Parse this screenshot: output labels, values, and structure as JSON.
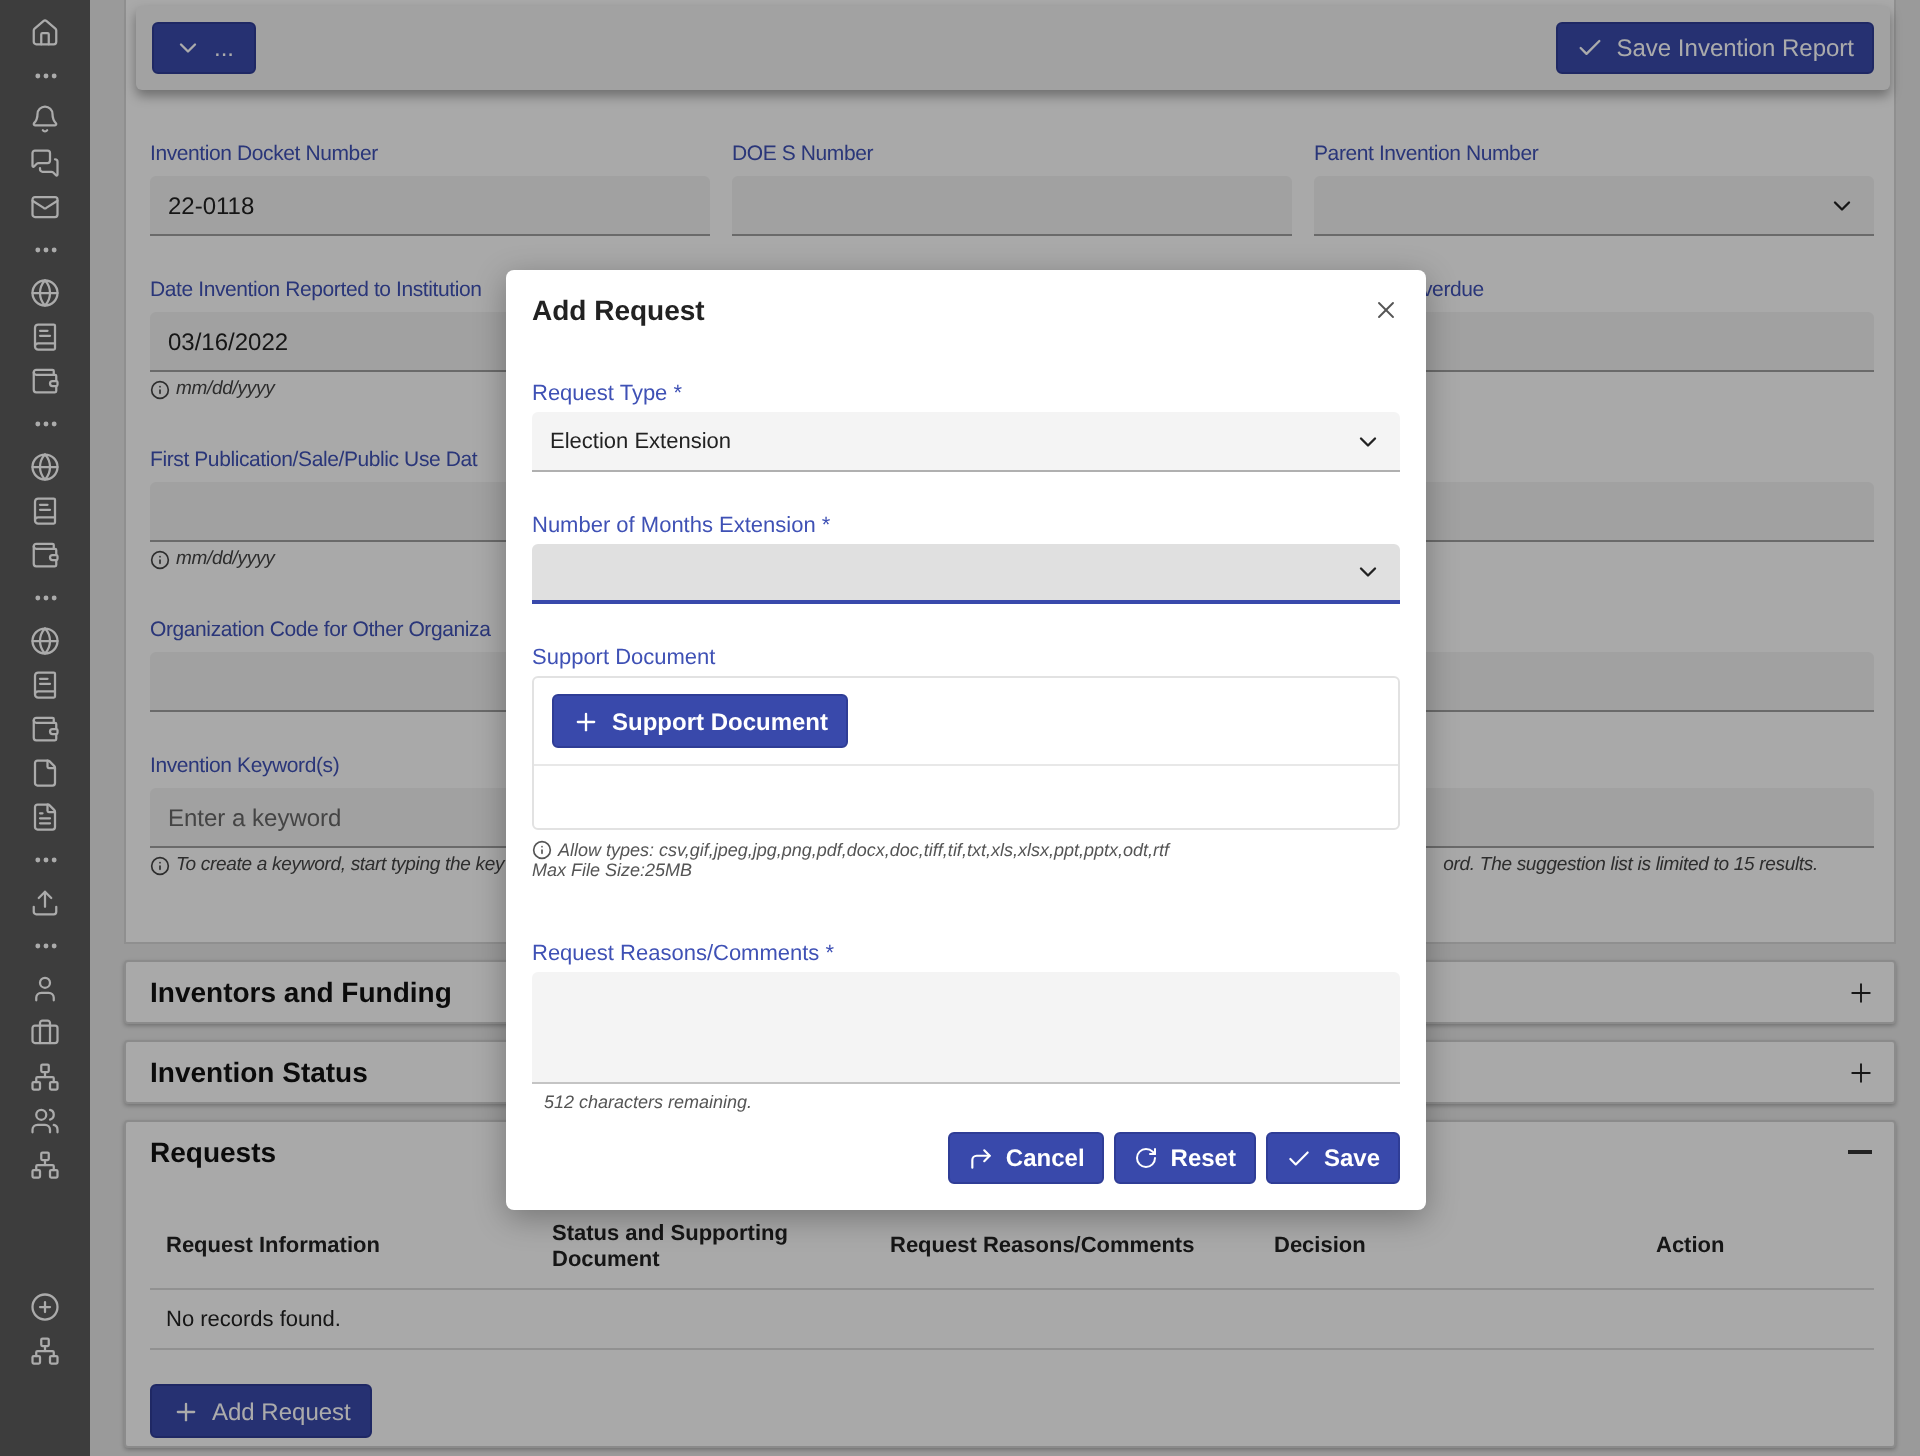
{
  "toolbar": {
    "menu_button": "...",
    "save_button": "Save Invention Report"
  },
  "form": {
    "rows": [
      {
        "fields": [
          {
            "kind": "text",
            "label": "Invention Docket Number",
            "value": "22-0118"
          },
          {
            "kind": "text",
            "label": "DOE S Number"
          },
          {
            "kind": "select",
            "label": "Parent Invention Number"
          }
        ]
      },
      {
        "fields": [
          {
            "kind": "text",
            "label": "Date Invention Reported to Institution",
            "value": "03/16/2022",
            "hint": "mm/dd/yyyy"
          },
          {
            "kind": "text",
            "label": "verdue"
          }
        ]
      },
      {
        "fields": [
          {
            "kind": "text",
            "label": "First Publication/Sale/Public Use Dat",
            "hint": "mm/dd/yyyy"
          },
          {
            "kind": "text"
          }
        ]
      },
      {
        "fields": [
          {
            "kind": "text",
            "label": "Organization Code for Other Organiza"
          },
          {
            "kind": "text"
          }
        ]
      },
      {
        "fields": [
          {
            "kind": "keyword",
            "label": "Invention Keyword(s)",
            "placeholder": "Enter a keyword",
            "hint_parts": [
              "To create a keyword, start typing the key",
              "ord. The suggestion list is limited to 15 results."
            ]
          }
        ]
      }
    ]
  },
  "sections": [
    {
      "title": "Inventors and Funding",
      "expanded": false
    },
    {
      "title": "Invention Status",
      "expanded": false
    },
    {
      "title": "Requests",
      "expanded": true,
      "table": {
        "columns": [
          "Request Information",
          "Status and Supporting Document",
          "Request Reasons/Comments",
          "Decision",
          "Action"
        ],
        "empty_message": "No records found."
      },
      "add_button": "Add Request"
    }
  ],
  "dialog": {
    "title": "Add Request",
    "fields": [
      {
        "kind": "select",
        "label": "Request Type *",
        "value": "Election Extension",
        "focused": false
      },
      {
        "kind": "select",
        "label": "Number of Months Extension *",
        "focused": true
      },
      {
        "kind": "upload",
        "label": "Support Document",
        "button": "Support Document",
        "hint": "Allow types: csv,gif,jpeg,jpg,png,pdf,docx,doc,tiff,tif,txt,xls,xlsx,ppt,pptx,odt,rtf",
        "note": "Max File Size:25MB"
      },
      {
        "kind": "textarea",
        "label": "Request Reasons/Comments *",
        "counter": "512 characters remaining."
      }
    ],
    "buttons": [
      {
        "kind": "cancel",
        "label": "Cancel"
      },
      {
        "kind": "reset",
        "label": "Reset"
      },
      {
        "kind": "save",
        "label": "Save"
      }
    ]
  }
}
